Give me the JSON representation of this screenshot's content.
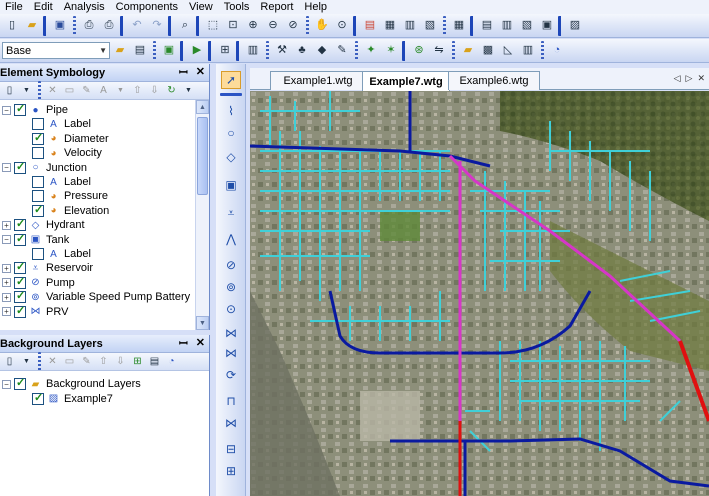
{
  "menu": [
    "File",
    "Edit",
    "Analysis",
    "Components",
    "View",
    "Tools",
    "Report",
    "Help"
  ],
  "scenario": {
    "value": "Base"
  },
  "symbology": {
    "title": "Element Symbology",
    "pin": "ꟷ",
    "close": "✕",
    "items": [
      {
        "label": "Pipe",
        "expander": "−",
        "checked": true,
        "indent": 0,
        "icon": "pipe-icon"
      },
      {
        "label": "Label",
        "expander": "",
        "checked": false,
        "indent": 1,
        "icon": "label-icon"
      },
      {
        "label": "Diameter",
        "expander": "",
        "checked": true,
        "indent": 1,
        "icon": "color-coding-icon"
      },
      {
        "label": "Velocity",
        "expander": "",
        "checked": false,
        "indent": 1,
        "icon": "color-coding-icon"
      },
      {
        "label": "Junction",
        "expander": "−",
        "checked": true,
        "indent": 0,
        "icon": "junction-icon"
      },
      {
        "label": "Label",
        "expander": "",
        "checked": false,
        "indent": 1,
        "icon": "label-icon"
      },
      {
        "label": "Pressure",
        "expander": "",
        "checked": false,
        "indent": 1,
        "icon": "color-coding-icon"
      },
      {
        "label": "Elevation",
        "expander": "",
        "checked": true,
        "indent": 1,
        "icon": "color-coding-icon"
      },
      {
        "label": "Hydrant",
        "expander": "+",
        "checked": true,
        "indent": 0,
        "icon": "hydrant-icon"
      },
      {
        "label": "Tank",
        "expander": "−",
        "checked": true,
        "indent": 0,
        "icon": "tank-icon"
      },
      {
        "label": "Label",
        "expander": "",
        "checked": false,
        "indent": 1,
        "icon": "label-icon"
      },
      {
        "label": "Reservoir",
        "expander": "+",
        "checked": true,
        "indent": 0,
        "icon": "reservoir-icon"
      },
      {
        "label": "Pump",
        "expander": "+",
        "checked": true,
        "indent": 0,
        "icon": "pump-icon"
      },
      {
        "label": "Variable Speed Pump Battery",
        "expander": "+",
        "checked": true,
        "indent": 0,
        "icon": "pump-battery-icon"
      },
      {
        "label": "PRV",
        "expander": "+",
        "checked": true,
        "indent": 0,
        "icon": "prv-icon"
      }
    ]
  },
  "background": {
    "title": "Background Layers",
    "pin": "ꟷ",
    "close": "✕",
    "items": [
      {
        "label": "Background Layers",
        "expander": "−",
        "checked": true,
        "indent": 0,
        "icon": "folder-icon"
      },
      {
        "label": "Example7",
        "expander": "",
        "checked": true,
        "indent": 1,
        "icon": "image-layer-icon"
      }
    ]
  },
  "tabs": [
    {
      "label": "Example1.wtg",
      "active": false
    },
    {
      "label": "Example7.wtg",
      "active": true
    },
    {
      "label": "Example6.wtg",
      "active": false
    }
  ],
  "tab_nav": [
    "◁",
    "▷",
    "✕"
  ],
  "colors": {
    "accent": "#2b54c4",
    "pipe_cyan": "#3fd0d8",
    "pipe_blue": "#0a1aa0",
    "pipe_magenta": "#d636c8",
    "pipe_red": "#e01010"
  }
}
